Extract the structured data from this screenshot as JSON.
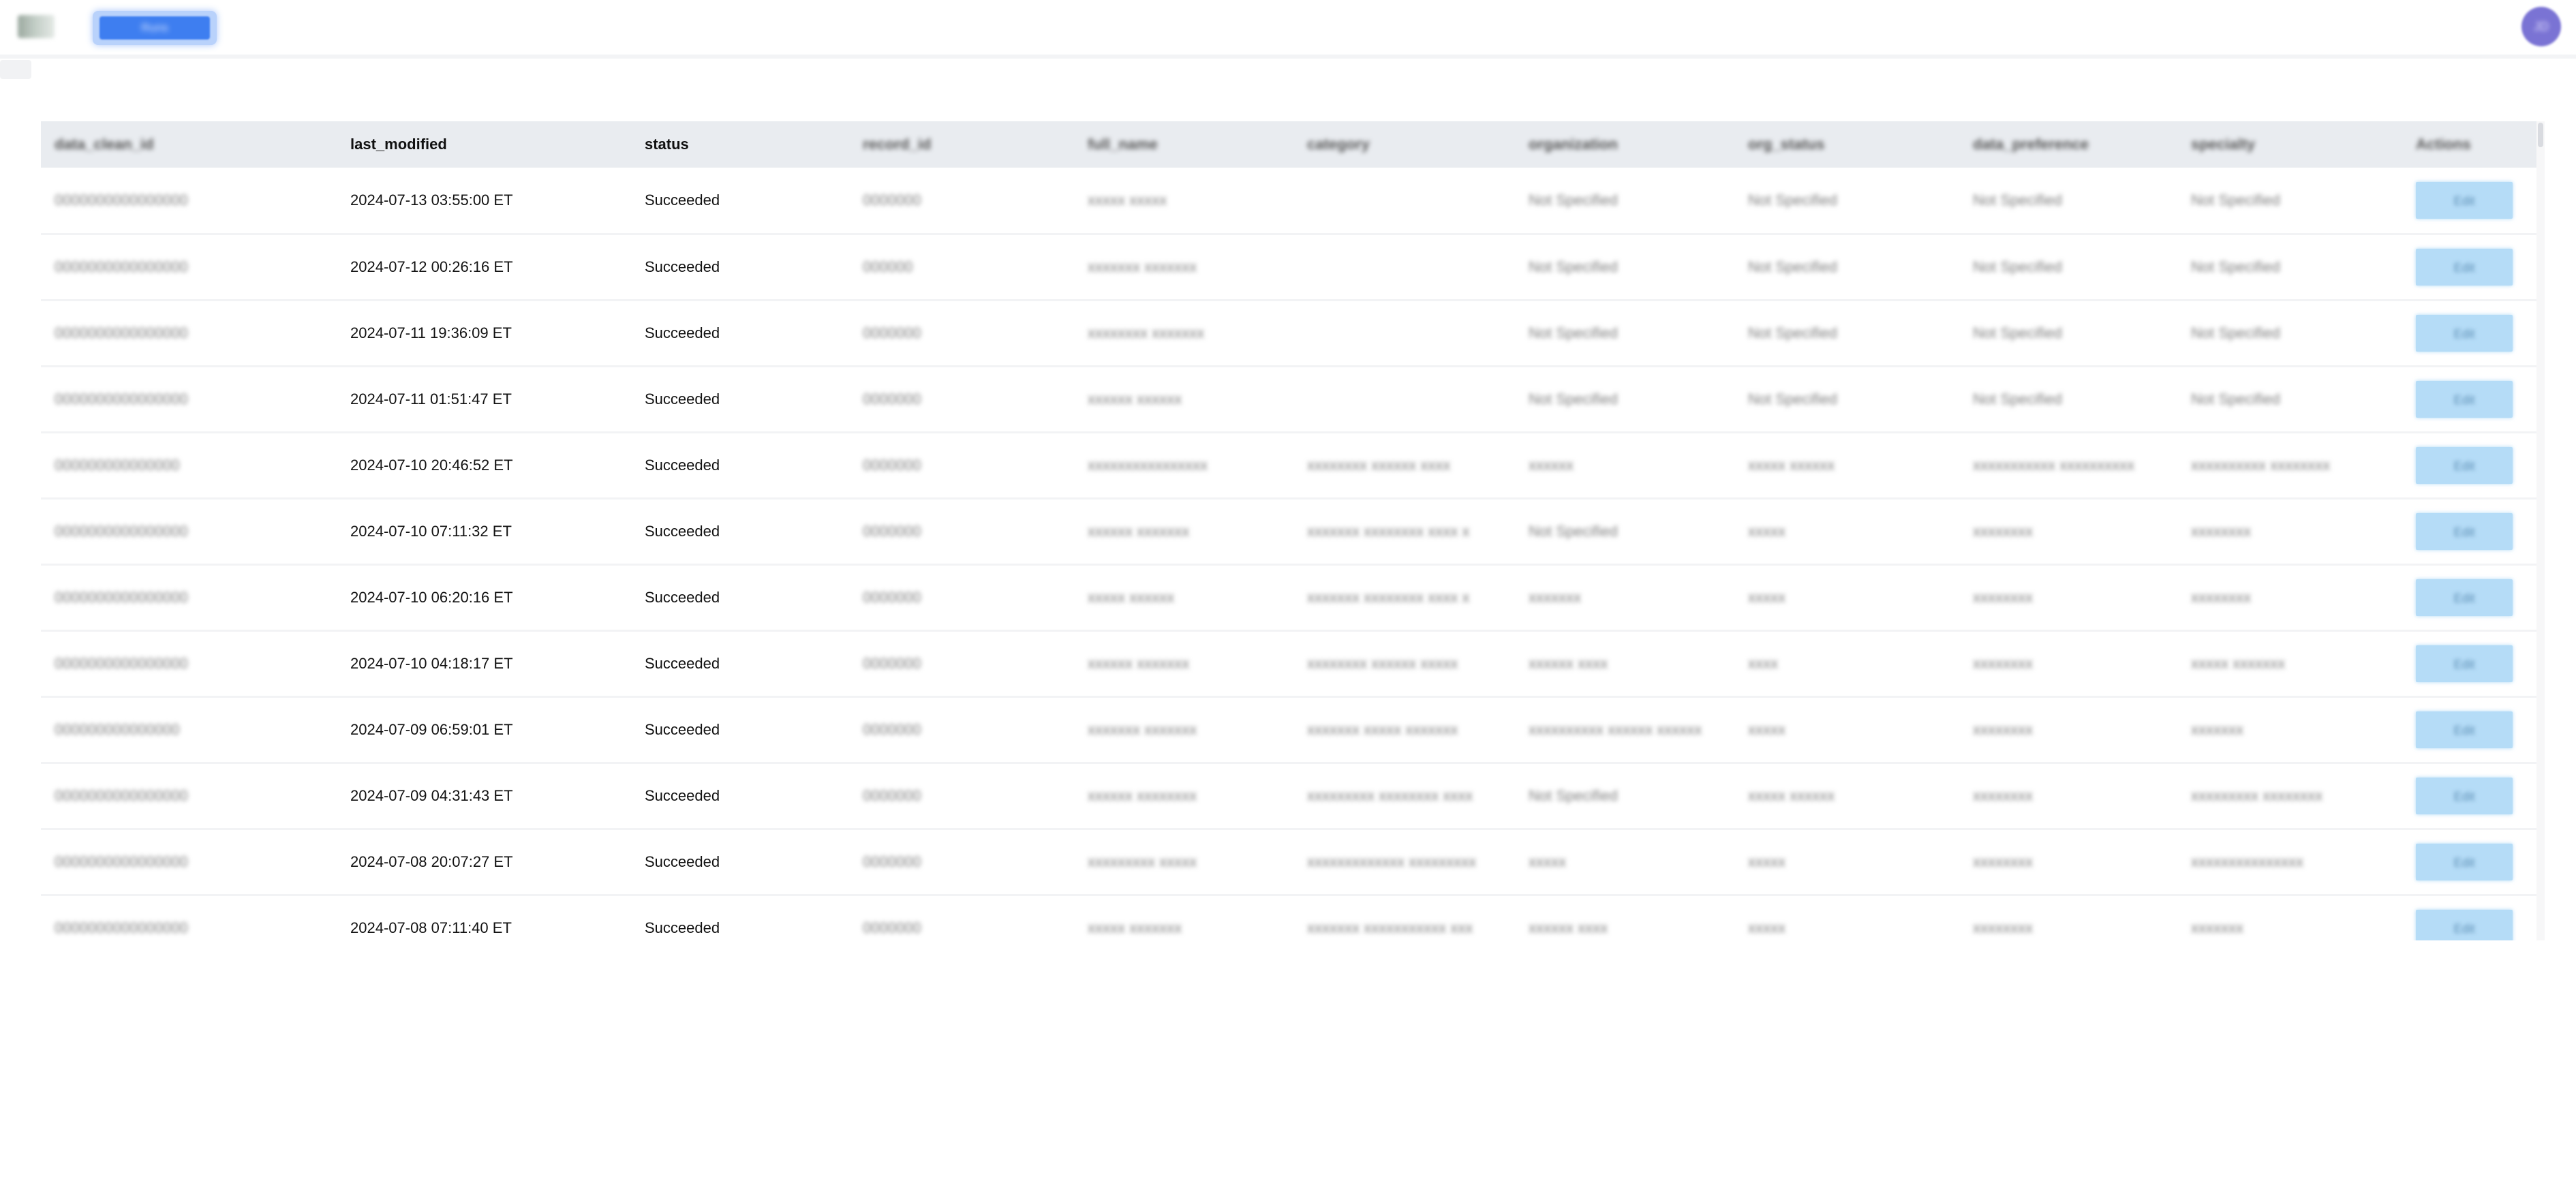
{
  "header": {
    "logo_label": "",
    "nav_active_label": "Runs",
    "avatar_initials": "JD"
  },
  "table": {
    "columns": [
      "data_clean_id",
      "last_modified",
      "status",
      "record_id",
      "full_name",
      "category",
      "organization",
      "org_status",
      "data_preference",
      "specialty",
      "Actions"
    ],
    "rows": [
      {
        "id": "0000000000000000",
        "last_modified": "2024-07-13 03:55:00 ET",
        "status": "Succeeded",
        "record": "0000000",
        "name": "xxxxx xxxxx",
        "category": "",
        "org": "Not Specified",
        "org_status": "Not Specified",
        "pref": "Not Specified",
        "specialty": "Not Specified",
        "action": "Edit"
      },
      {
        "id": "0000000000000000",
        "last_modified": "2024-07-12 00:26:16 ET",
        "status": "Succeeded",
        "record": "000000",
        "name": "xxxxxxx xxxxxxx",
        "category": "",
        "org": "Not Specified",
        "org_status": "Not Specified",
        "pref": "Not Specified",
        "specialty": "Not Specified",
        "action": "Edit"
      },
      {
        "id": "0000000000000000",
        "last_modified": "2024-07-11 19:36:09 ET",
        "status": "Succeeded",
        "record": "0000000",
        "name": "xxxxxxxx xxxxxxx",
        "category": "",
        "org": "Not Specified",
        "org_status": "Not Specified",
        "pref": "Not Specified",
        "specialty": "Not Specified",
        "action": "Edit"
      },
      {
        "id": "0000000000000000",
        "last_modified": "2024-07-11 01:51:47 ET",
        "status": "Succeeded",
        "record": "0000000",
        "name": "xxxxxx xxxxxx",
        "category": "",
        "org": "Not Specified",
        "org_status": "Not Specified",
        "pref": "Not Specified",
        "specialty": "Not Specified",
        "action": "Edit"
      },
      {
        "id": "000000000000000",
        "last_modified": "2024-07-10 20:46:52 ET",
        "status": "Succeeded",
        "record": "0000000",
        "name": "xxxxxxxxxxxxxxxx",
        "category": "xxxxxxxx xxxxxx xxxx",
        "org": "xxxxxx",
        "org_status": "xxxxx xxxxxx",
        "pref": "xxxxxxxxxxx xxxxxxxxxx",
        "specialty": "xxxxxxxxxx xxxxxxxx",
        "action": "Edit"
      },
      {
        "id": "0000000000000000",
        "last_modified": "2024-07-10 07:11:32 ET",
        "status": "Succeeded",
        "record": "0000000",
        "name": "xxxxxx xxxxxxx",
        "category": "xxxxxxx xxxxxxxx xxxx x",
        "org": "Not Specified",
        "org_status": "xxxxx",
        "pref": "xxxxxxxx",
        "specialty": "xxxxxxxx",
        "action": "Edit"
      },
      {
        "id": "0000000000000000",
        "last_modified": "2024-07-10 06:20:16 ET",
        "status": "Succeeded",
        "record": "0000000",
        "name": "xxxxx xxxxxx",
        "category": "xxxxxxx xxxxxxxx xxxx x",
        "org": "xxxxxxx",
        "org_status": "xxxxx",
        "pref": "xxxxxxxx",
        "specialty": "xxxxxxxx",
        "action": "Edit"
      },
      {
        "id": "0000000000000000",
        "last_modified": "2024-07-10 04:18:17 ET",
        "status": "Succeeded",
        "record": "0000000",
        "name": "xxxxxx xxxxxxx",
        "category": "xxxxxxxx xxxxxx xxxxx",
        "org": "xxxxxx xxxx",
        "org_status": "xxxx",
        "pref": "xxxxxxxx",
        "specialty": "xxxxx xxxxxxx",
        "action": "Edit"
      },
      {
        "id": "000000000000000",
        "last_modified": "2024-07-09 06:59:01 ET",
        "status": "Succeeded",
        "record": "0000000",
        "name": "xxxxxxx xxxxxxx",
        "category": "xxxxxxx xxxxx xxxxxxx",
        "org": "xxxxxxxxxx xxxxxx xxxxxx",
        "org_status": "xxxxx",
        "pref": "xxxxxxxx",
        "specialty": "xxxxxxx",
        "action": "Edit"
      },
      {
        "id": "0000000000000000",
        "last_modified": "2024-07-09 04:31:43 ET",
        "status": "Succeeded",
        "record": "0000000",
        "name": "xxxxxx xxxxxxxx",
        "category": "xxxxxxxxx xxxxxxxx xxxx",
        "org": "Not Specified",
        "org_status": "xxxxx xxxxxx",
        "pref": "xxxxxxxx",
        "specialty": "xxxxxxxxx xxxxxxxx",
        "action": "Edit"
      },
      {
        "id": "0000000000000000",
        "last_modified": "2024-07-08 20:07:27 ET",
        "status": "Succeeded",
        "record": "0000000",
        "name": "xxxxxxxxx xxxxx",
        "category": "xxxxxxxxxxxxx xxxxxxxxx",
        "org": "xxxxx",
        "org_status": "xxxxx",
        "pref": "xxxxxxxx",
        "specialty": "xxxxxxxxxxxxxxx",
        "action": "Edit"
      },
      {
        "id": "0000000000000000",
        "last_modified": "2024-07-08 07:11:40 ET",
        "status": "Succeeded",
        "record": "0000000",
        "name": "xxxxx xxxxxxx",
        "category": "xxxxxxx xxxxxxxxxxx xxx",
        "org": "xxxxxx xxxx",
        "org_status": "xxxxx",
        "pref": "xxxxxxxx",
        "specialty": "xxxxxxx",
        "action": "Edit"
      }
    ]
  }
}
